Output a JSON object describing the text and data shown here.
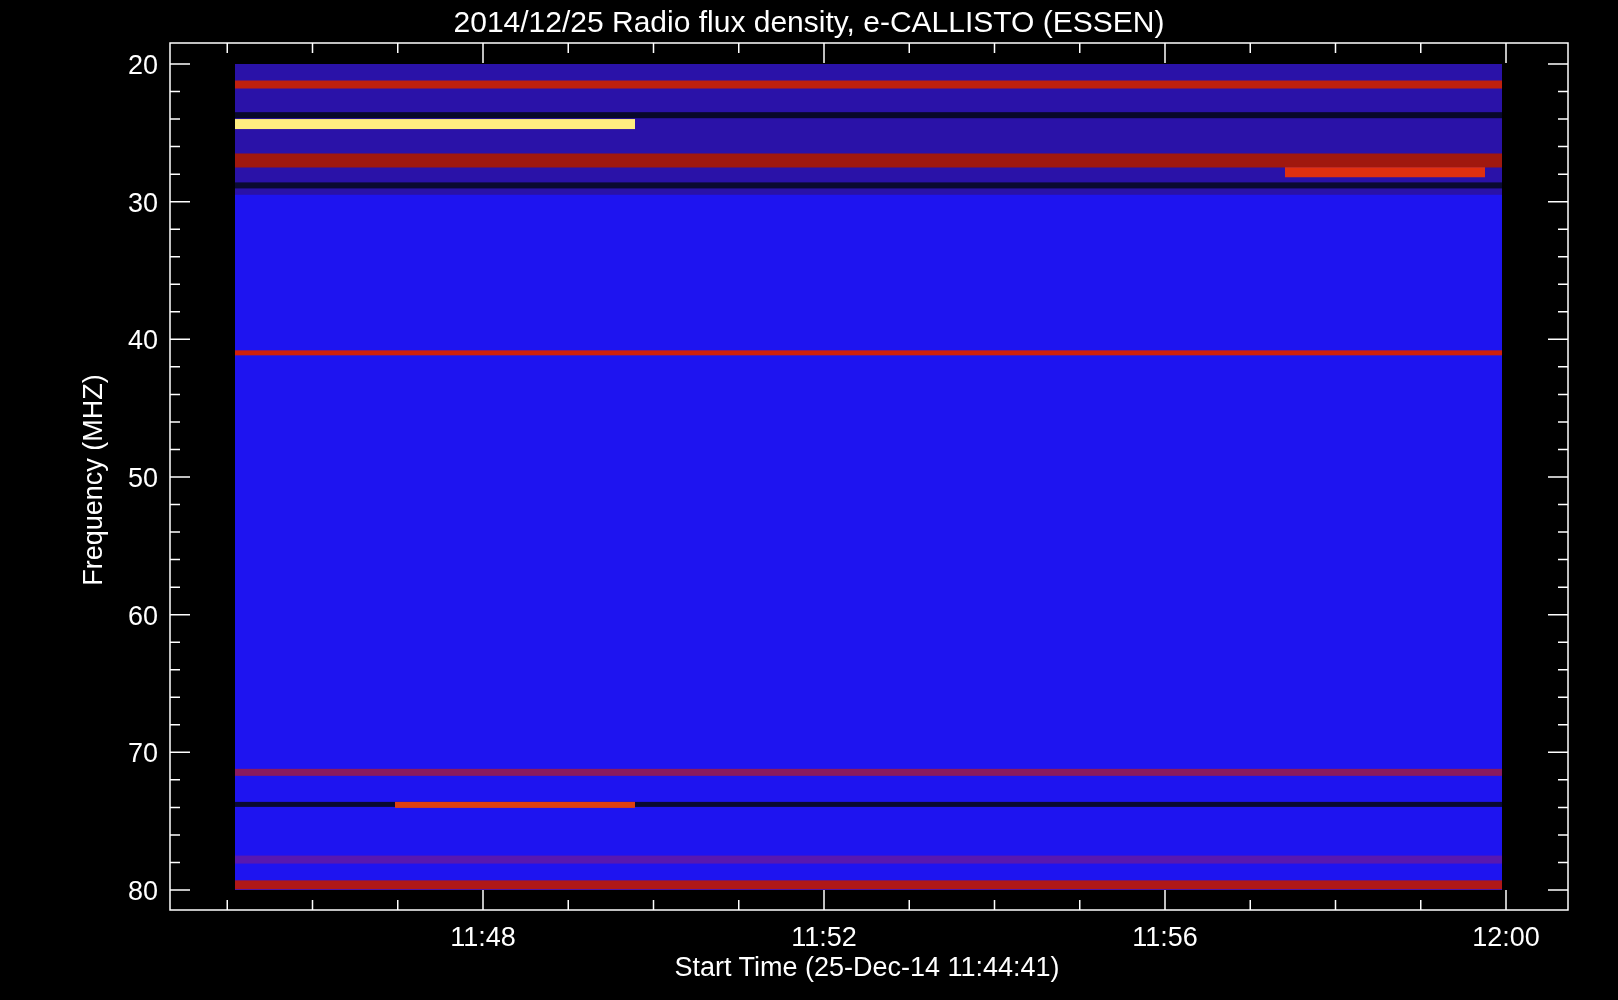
{
  "title": "2014/12/25  Radio flux density, e-CALLISTO (ESSEN)",
  "y_axis": {
    "label": "Frequency (MHZ)",
    "ticks": [
      "20",
      "30",
      "40",
      "50",
      "60",
      "70",
      "80"
    ]
  },
  "x_axis": {
    "label": "Start Time (25-Dec-14 11:44:41)",
    "ticks": [
      "11:48",
      "11:52",
      "11:56",
      "12:00"
    ]
  }
}
